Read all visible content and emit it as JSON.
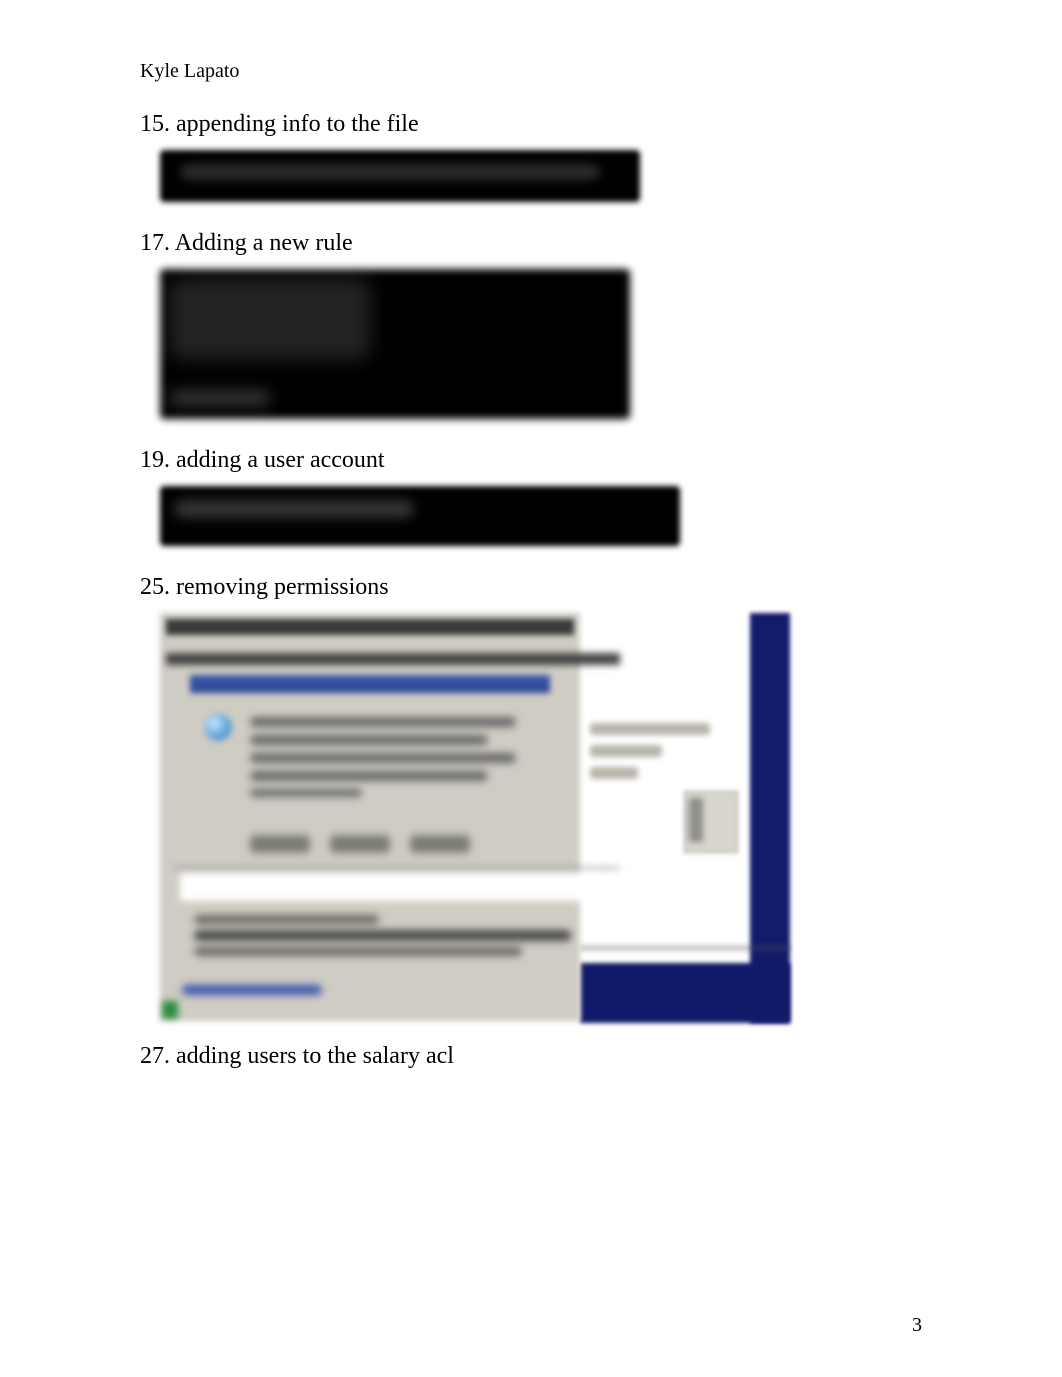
{
  "author": "Kyle Lapato",
  "items": [
    {
      "number": "15.",
      "text": "appending info to the file"
    },
    {
      "number": "17.",
      "text": "Adding a new rule"
    },
    {
      "number": "19.",
      "text": "adding a user account"
    },
    {
      "number": "25.",
      "text": "removing permissions"
    },
    {
      "number": "27.",
      "text": "adding users to the salary acl"
    }
  ],
  "page_number": "3"
}
